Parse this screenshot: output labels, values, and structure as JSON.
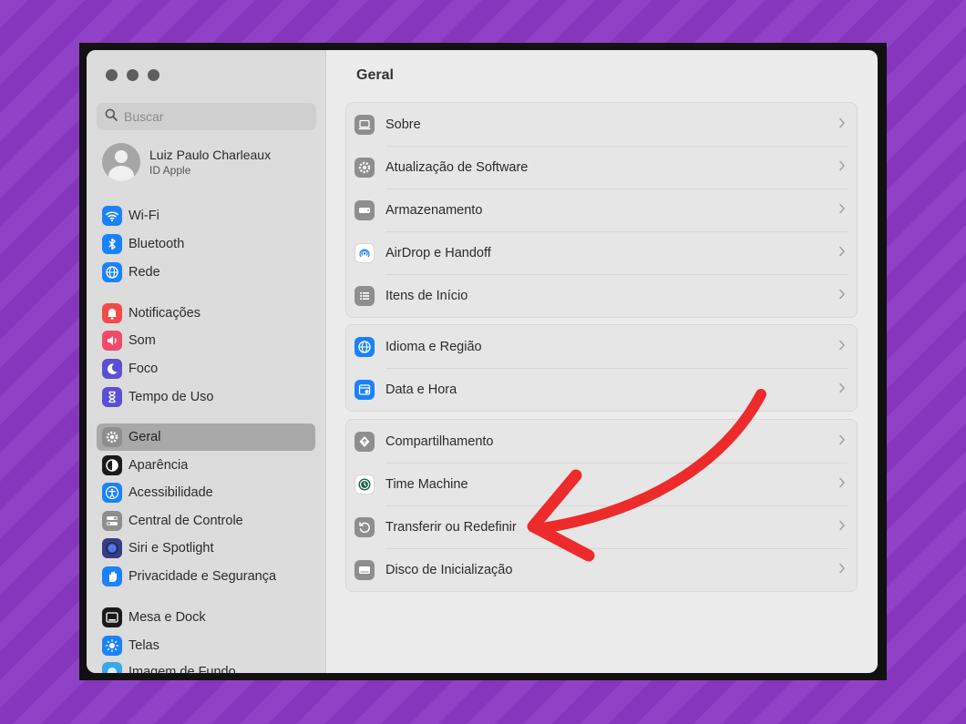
{
  "sidebar": {
    "search_placeholder": "Buscar",
    "profile": {
      "name": "Luiz Paulo Charleaux",
      "subtitle": "ID Apple"
    },
    "items": [
      {
        "label": "Wi-Fi",
        "icon": "wifi-icon",
        "color": "#1a82fb"
      },
      {
        "label": "Bluetooth",
        "icon": "bluetooth-icon",
        "color": "#1a82fb"
      },
      {
        "label": "Rede",
        "icon": "globe-icon",
        "color": "#1a82fb"
      },
      {
        "label": "Notificações",
        "icon": "bell-icon",
        "color": "#f24a4a"
      },
      {
        "label": "Som",
        "icon": "speaker-icon",
        "color": "#f24a6a"
      },
      {
        "label": "Foco",
        "icon": "moon-icon",
        "color": "#5b4fd6"
      },
      {
        "label": "Tempo de Uso",
        "icon": "hourglass-icon",
        "color": "#5b4fd6"
      },
      {
        "label": "Geral",
        "icon": "gear-icon",
        "color": "#8e8e8e",
        "active": true
      },
      {
        "label": "Aparência",
        "icon": "appearance-icon",
        "color": "#1a1a1a"
      },
      {
        "label": "Acessibilidade",
        "icon": "accessibility-icon",
        "color": "#1a82fb"
      },
      {
        "label": "Central de Controle",
        "icon": "toggles-icon",
        "color": "#8e8e8e"
      },
      {
        "label": "Siri e Spotlight",
        "icon": "siri-icon",
        "color": "#3a3a8a"
      },
      {
        "label": "Privacidade e Segurança",
        "icon": "hand-icon",
        "color": "#1a82fb"
      },
      {
        "label": "Mesa e Dock",
        "icon": "dock-icon",
        "color": "#1a1a1a"
      },
      {
        "label": "Telas",
        "icon": "sun-icon",
        "color": "#1a82fb"
      },
      {
        "label": "Imagem de Fundo",
        "icon": "wallpaper-icon",
        "color": "#37a8e8"
      }
    ]
  },
  "main": {
    "title": "Geral",
    "groups": [
      [
        {
          "label": "Sobre",
          "icon": "laptop-icon",
          "color": "#8e8e8e"
        },
        {
          "label": "Atualização de Software",
          "icon": "gear-update-icon",
          "color": "#8e8e8e"
        },
        {
          "label": "Armazenamento",
          "icon": "drive-icon",
          "color": "#8e8e8e"
        },
        {
          "label": "AirDrop e Handoff",
          "icon": "airdrop-icon",
          "color": "#ffffff"
        },
        {
          "label": "Itens de Início",
          "icon": "list-icon",
          "color": "#8e8e8e"
        }
      ],
      [
        {
          "label": "Idioma e Região",
          "icon": "globe-icon",
          "color": "#1a82fb"
        },
        {
          "label": "Data e Hora",
          "icon": "calendar-icon",
          "color": "#1a82fb"
        }
      ],
      [
        {
          "label": "Compartilhamento",
          "icon": "sharing-icon",
          "color": "#8e8e8e"
        },
        {
          "label": "Time Machine",
          "icon": "time-machine-icon",
          "color": "#ffffff"
        },
        {
          "label": "Transferir ou Redefinir",
          "icon": "reset-icon",
          "color": "#8e8e8e"
        },
        {
          "label": "Disco de Inicialização",
          "icon": "startup-disk-icon",
          "color": "#8e8e8e"
        }
      ]
    ]
  },
  "annotation": {
    "arrow_color": "#ee2b2b"
  }
}
